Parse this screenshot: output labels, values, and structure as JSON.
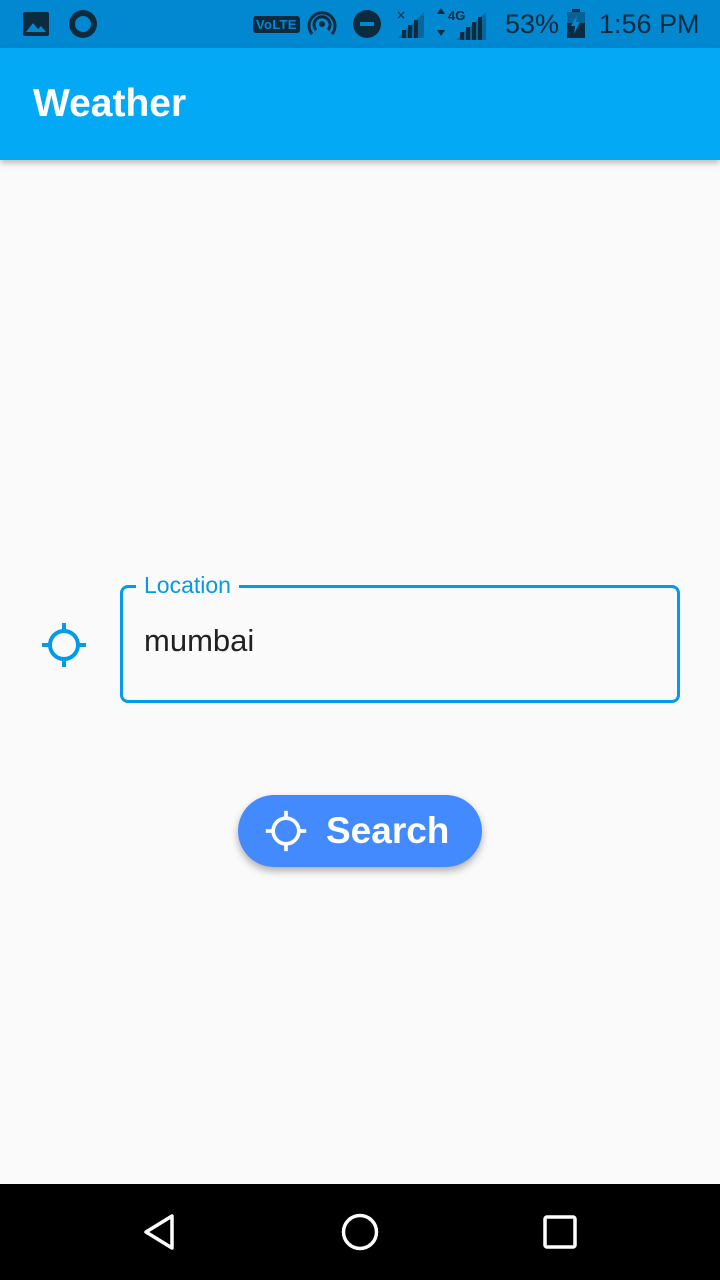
{
  "status_bar": {
    "volte": "VoLTE",
    "network_type": "4G",
    "battery_percent": "53%",
    "time": "1:56 PM",
    "icons": [
      "gallery-icon",
      "circle-app-icon",
      "hotspot-icon",
      "do-not-disturb-icon",
      "signal-icon",
      "battery-icon"
    ]
  },
  "app_bar": {
    "title": "Weather"
  },
  "location_field": {
    "label": "Location",
    "value": "mumbai",
    "icon": "gps-crosshair-icon"
  },
  "search_button": {
    "label": "Search",
    "icon": "gps-crosshair-icon"
  },
  "nav_bar": {
    "buttons": [
      "back-icon",
      "home-icon",
      "recents-icon"
    ]
  },
  "colors": {
    "status_bar": "#0288d1",
    "app_bar": "#03a9f4",
    "accent": "#039be5",
    "button": "#448aff",
    "background": "#fafafa"
  }
}
